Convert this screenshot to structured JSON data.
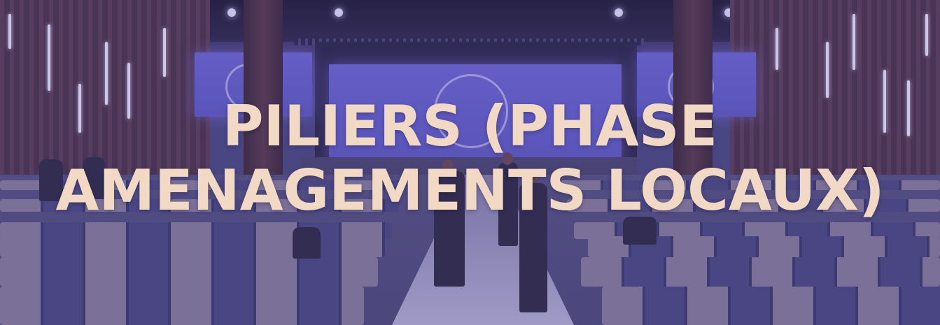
{
  "hero": {
    "title_line1": "PILIERS (PHASE",
    "title_line2": "AMENAGEMENTS LOCAUX)",
    "title_color": "#f2d9c6",
    "overlay_color": "#483a8c"
  }
}
